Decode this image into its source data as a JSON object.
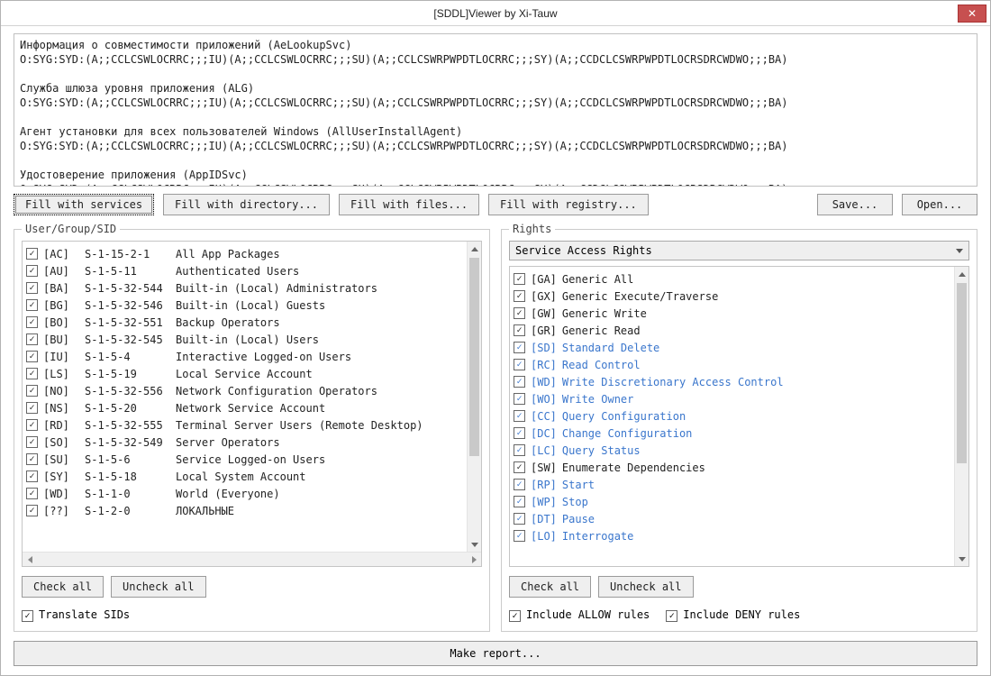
{
  "window": {
    "title": "[SDDL]Viewer by Xi-Tauw"
  },
  "sddl_text": "Информация о совместимости приложений (AeLookupSvc)\nO:SYG:SYD:(A;;CCLCSWLOCRRC;;;IU)(A;;CCLCSWLOCRRC;;;SU)(A;;CCLCSWRPWPDTLOCRRC;;;SY)(A;;CCDCLCSWRPWPDTLOCRSDRCWDWO;;;BA)\n\nСлужба шлюза уровня приложения (ALG)\nO:SYG:SYD:(A;;CCLCSWLOCRRC;;;IU)(A;;CCLCSWLOCRRC;;;SU)(A;;CCLCSWRPWPDTLOCRRC;;;SY)(A;;CCDCLCSWRPWPDTLOCRSDRCWDWO;;;BA)\n\nАгент установки для всех пользователей Windows (AllUserInstallAgent)\nO:SYG:SYD:(A;;CCLCSWLOCRRC;;;IU)(A;;CCLCSWLOCRRC;;;SU)(A;;CCLCSWRPWPDTLOCRRC;;;SY)(A;;CCDCLCSWRPWPDTLOCRSDRCWDWO;;;BA)\n\nУдостоверение приложения (AppIDSvc)\nO:SYG:SYD:(A;;CCLCSWLOCRRC;;;IU)(A;;CCLCSWLOCRRC;;;SU)(A;;CCLCSWRPWPDTLOCRRC;;;SY)(A;;CCDCLCSWRPWPDTLOCRSDRCWDWO;;;BA)",
  "toolbar": {
    "fill_services": "Fill with services",
    "fill_directory": "Fill with directory...",
    "fill_files": "Fill with files...",
    "fill_registry": "Fill with registry...",
    "save": "Save...",
    "open": "Open..."
  },
  "left_panel": {
    "legend": "User/Group/SID",
    "items": [
      {
        "code": "[AC]",
        "sid": "S-1-15-2-1",
        "name": "All App Packages",
        "checked": true
      },
      {
        "code": "[AU]",
        "sid": "S-1-5-11",
        "name": "Authenticated Users",
        "checked": true
      },
      {
        "code": "[BA]",
        "sid": "S-1-5-32-544",
        "name": "Built-in (Local) Administrators",
        "checked": true
      },
      {
        "code": "[BG]",
        "sid": "S-1-5-32-546",
        "name": "Built-in (Local) Guests",
        "checked": true
      },
      {
        "code": "[BO]",
        "sid": "S-1-5-32-551",
        "name": "Backup Operators",
        "checked": true
      },
      {
        "code": "[BU]",
        "sid": "S-1-5-32-545",
        "name": "Built-in (Local) Users",
        "checked": true
      },
      {
        "code": "[IU]",
        "sid": "S-1-5-4",
        "name": "Interactive Logged-on Users",
        "checked": true
      },
      {
        "code": "[LS]",
        "sid": "S-1-5-19",
        "name": "Local Service Account",
        "checked": true
      },
      {
        "code": "[NO]",
        "sid": "S-1-5-32-556",
        "name": "Network Configuration Operators",
        "checked": true
      },
      {
        "code": "[NS]",
        "sid": "S-1-5-20",
        "name": "Network Service Account",
        "checked": true
      },
      {
        "code": "[RD]",
        "sid": "S-1-5-32-555",
        "name": "Terminal Server Users (Remote Desktop)",
        "checked": true
      },
      {
        "code": "[SO]",
        "sid": "S-1-5-32-549",
        "name": "Server Operators",
        "checked": true
      },
      {
        "code": "[SU]",
        "sid": "S-1-5-6",
        "name": "Service Logged-on Users",
        "checked": true
      },
      {
        "code": "[SY]",
        "sid": "S-1-5-18",
        "name": "Local System Account",
        "checked": true
      },
      {
        "code": "[WD]",
        "sid": "S-1-1-0",
        "name": "World (Everyone)",
        "checked": true
      },
      {
        "code": "[??]",
        "sid": "S-1-2-0",
        "name": "ЛОКАЛЬНЫЕ",
        "checked": true
      }
    ],
    "check_all": "Check all",
    "uncheck_all": "Uncheck all",
    "translate_sids": "Translate SIDs"
  },
  "right_panel": {
    "legend": "Rights",
    "dropdown": "Service Access Rights",
    "items": [
      {
        "code": "[GA]",
        "name": "Generic All",
        "checked": true,
        "hl": false
      },
      {
        "code": "[GX]",
        "name": "Generic Execute/Traverse",
        "checked": true,
        "hl": false
      },
      {
        "code": "[GW]",
        "name": "Generic Write",
        "checked": true,
        "hl": false
      },
      {
        "code": "[GR]",
        "name": "Generic Read",
        "checked": true,
        "hl": false
      },
      {
        "code": "[SD]",
        "name": "Standard Delete",
        "checked": true,
        "hl": true
      },
      {
        "code": "[RC]",
        "name": "Read Control",
        "checked": true,
        "hl": true
      },
      {
        "code": "[WD]",
        "name": "Write Discretionary Access Control",
        "checked": true,
        "hl": true
      },
      {
        "code": "[WO]",
        "name": "Write Owner",
        "checked": true,
        "hl": true
      },
      {
        "code": "[CC]",
        "name": "Query Configuration",
        "checked": true,
        "hl": true
      },
      {
        "code": "[DC]",
        "name": "Change Configuration",
        "checked": true,
        "hl": true
      },
      {
        "code": "[LC]",
        "name": "Query Status",
        "checked": true,
        "hl": true
      },
      {
        "code": "[SW]",
        "name": "Enumerate Dependencies",
        "checked": true,
        "hl": false
      },
      {
        "code": "[RP]",
        "name": "Start",
        "checked": true,
        "hl": true
      },
      {
        "code": "[WP]",
        "name": "Stop",
        "checked": true,
        "hl": true
      },
      {
        "code": "[DT]",
        "name": "Pause",
        "checked": true,
        "hl": true
      },
      {
        "code": "[LO]",
        "name": "Interrogate",
        "checked": true,
        "hl": true
      }
    ],
    "check_all": "Check all",
    "uncheck_all": "Uncheck all",
    "include_allow": "Include ALLOW rules",
    "include_deny": "Include DENY rules"
  },
  "make_report": "Make report..."
}
